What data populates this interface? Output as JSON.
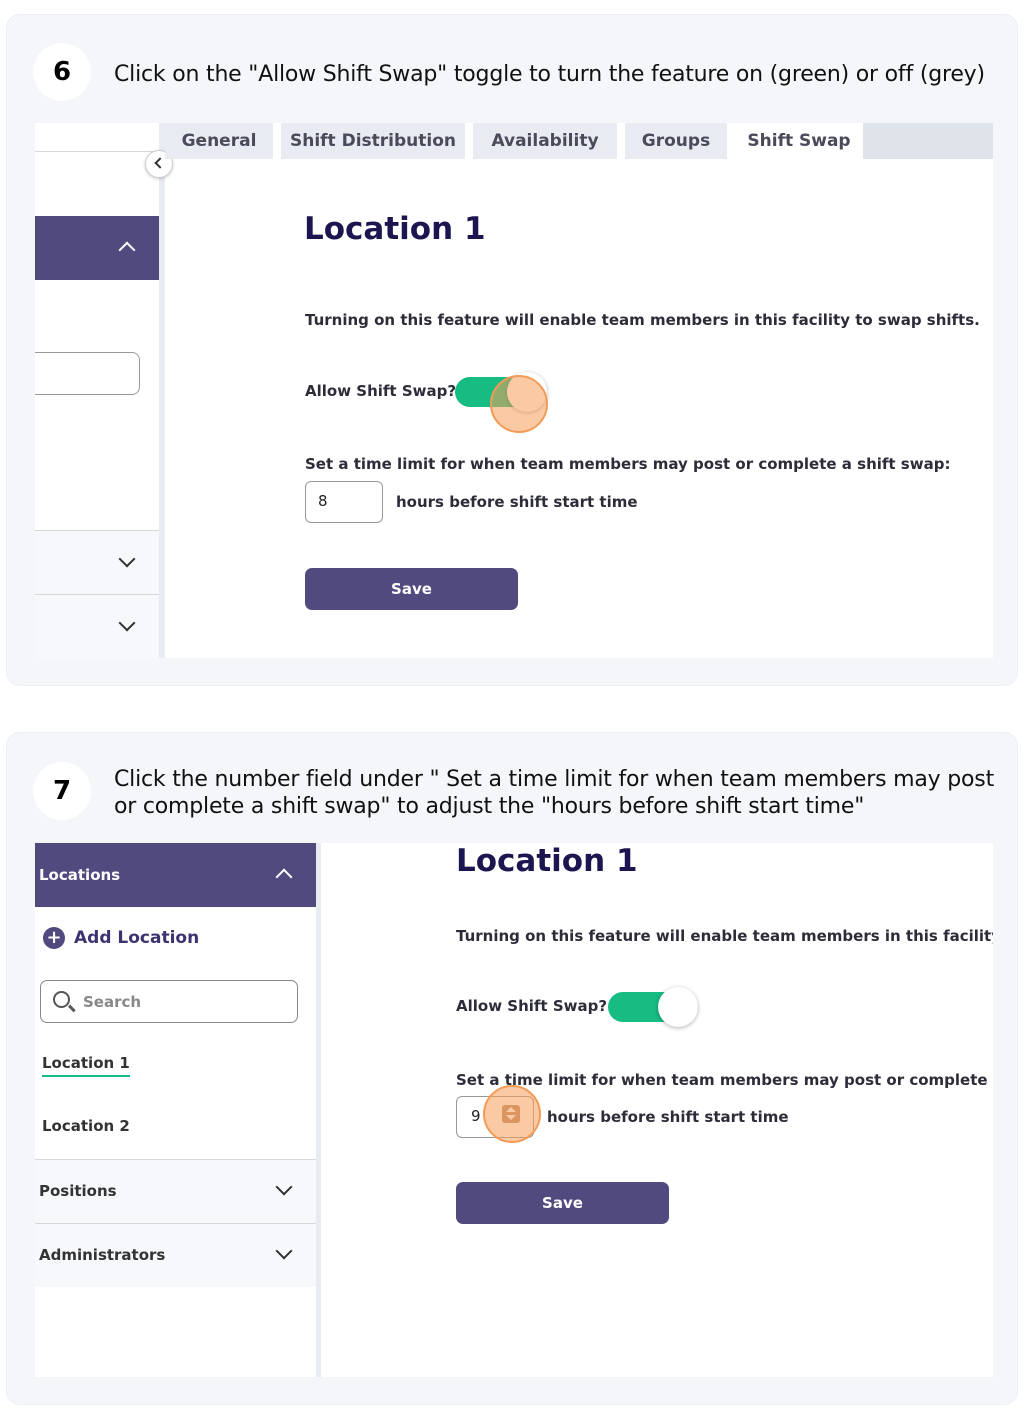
{
  "steps": [
    {
      "number": "6",
      "instruction": "Click on the \"Allow Shift Swap\" toggle to turn the feature on (green) or off (grey)",
      "tabs": [
        "General",
        "Shift Distribution",
        "Availability",
        "Groups",
        "Shift Swap"
      ],
      "active_tab": "Shift Swap",
      "location_title": "Location 1",
      "description": "Turning on this feature will enable team members in this facility to swap shifts.",
      "toggle_label": "Allow Shift Swap?",
      "toggle_on": true,
      "time_limit_label": "Set a time limit for when team members may post or complete a shift swap:",
      "hours_value": "8",
      "hours_suffix": "hours before shift start time",
      "save_label": "Save"
    },
    {
      "number": "7",
      "instruction_line1": "Click the number field under \" Set a time limit for when team members may post",
      "instruction_line2": "or complete a shift swap\" to adjust the \"hours before shift start time\"",
      "sidebar": {
        "locations_header": "Locations",
        "add_location": "Add Location",
        "search_placeholder": "Search",
        "items": [
          "Location 1",
          "Location 2"
        ],
        "positions": "Positions",
        "administrators": "Administrators"
      },
      "location_title": "Location 1",
      "description": "Turning on this feature will enable team members in this facility to sv",
      "toggle_label": "Allow Shift Swap?",
      "toggle_on": true,
      "time_limit_label": "Set a time limit for when team members may post or complete a shif",
      "hours_value": "9",
      "hours_suffix": "hours before shift start time",
      "save_label": "Save"
    }
  ]
}
